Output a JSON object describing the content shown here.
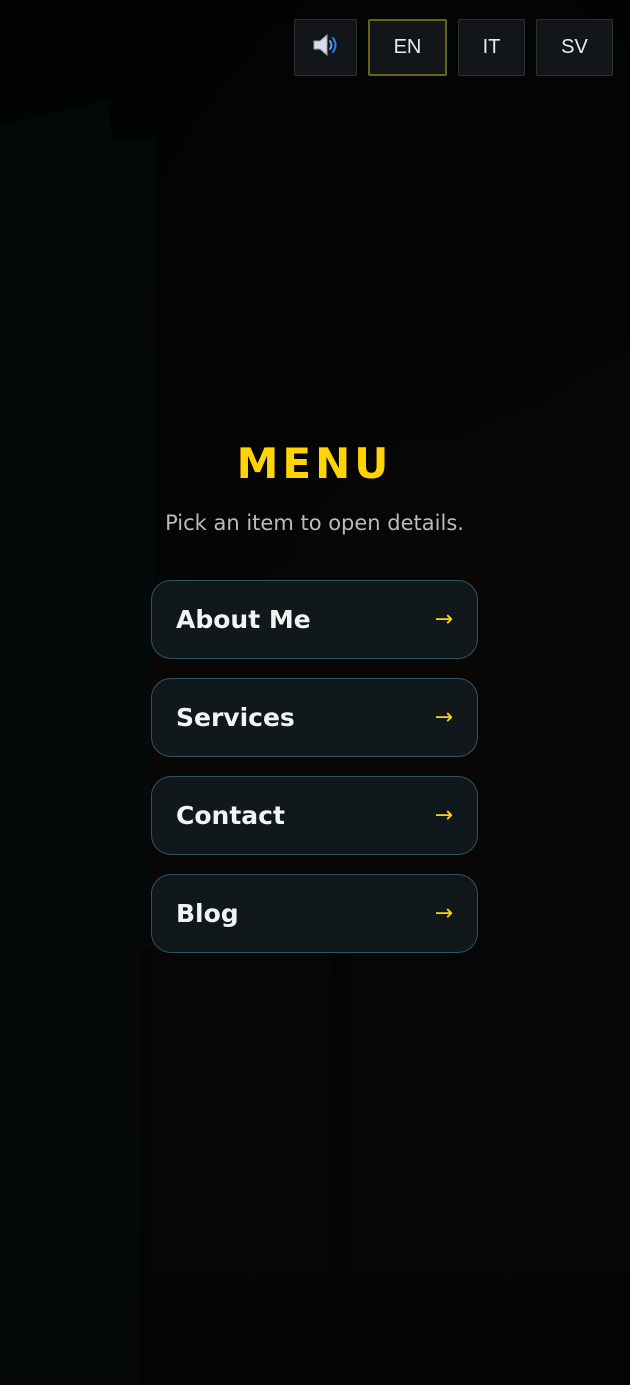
{
  "colors": {
    "accent": "#ffd400",
    "background": "#030606",
    "card_border": "#2f5563",
    "card_background": "#121c20"
  },
  "topbar": {
    "sound_icon": "speaker-volume-icon",
    "languages": [
      {
        "label": "EN",
        "active": true
      },
      {
        "label": "IT",
        "active": false
      },
      {
        "label": "SV",
        "active": false
      }
    ]
  },
  "menu": {
    "title": "MENU",
    "subtitle": "Pick an item to open details.",
    "arrow_icon": "arrow-right-icon",
    "items": [
      {
        "label": "About Me",
        "arrow": "→"
      },
      {
        "label": "Services",
        "arrow": "→"
      },
      {
        "label": "Contact",
        "arrow": "→"
      },
      {
        "label": "Blog",
        "arrow": "→"
      }
    ]
  }
}
